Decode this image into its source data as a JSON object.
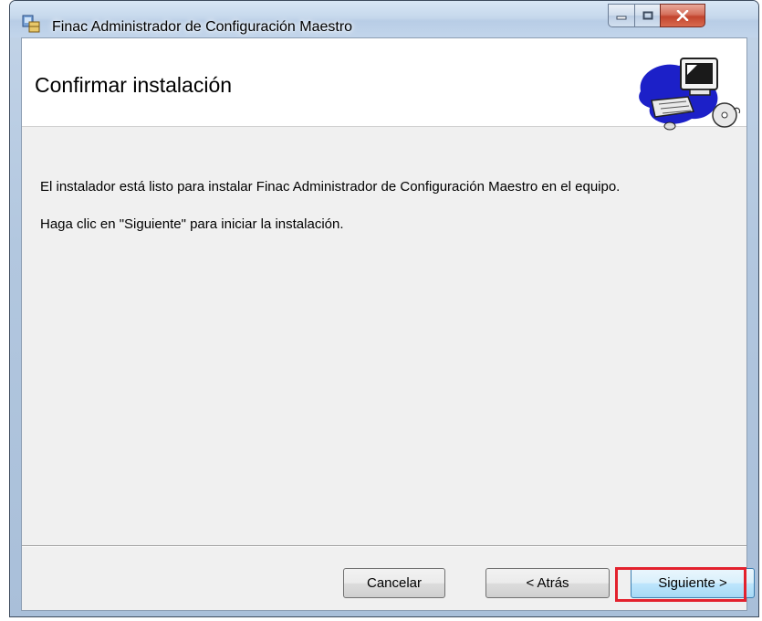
{
  "window": {
    "title": "Finac Administrador de Configuración Maestro",
    "controls": {
      "minimize": "minimize",
      "maximize": "maximize",
      "close": "close"
    }
  },
  "header": {
    "title": "Confirmar instalación"
  },
  "body": {
    "line1": "El instalador está listo para instalar Finac Administrador de Configuración Maestro en el equipo.",
    "line2": "Haga clic en \"Siguiente\" para iniciar la instalación."
  },
  "buttons": {
    "cancel": "Cancelar",
    "back": "< Atrás",
    "next": "Siguiente >"
  },
  "colors": {
    "highlight": "#e3212d",
    "accent_button": "#a7d9f5"
  }
}
